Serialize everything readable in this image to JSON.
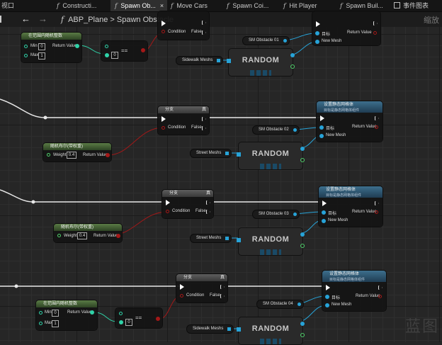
{
  "tabs": [
    {
      "label": "视口",
      "has_fx": false,
      "active": false
    },
    {
      "label": "Constructi...",
      "has_fx": true,
      "active": false
    },
    {
      "label": "Spawn Ob...",
      "has_fx": true,
      "active": true,
      "close": "×"
    },
    {
      "label": "Move Cars",
      "has_fx": true,
      "active": false
    },
    {
      "label": "Spawn Coi...",
      "has_fx": true,
      "active": false
    },
    {
      "label": "Hit Player",
      "has_fx": true,
      "active": false
    },
    {
      "label": "Spawn Buil...",
      "has_fx": true,
      "active": false
    },
    {
      "label": "事件图表",
      "has_fx": false,
      "active": false,
      "icon": "grid-icon"
    }
  ],
  "toolbar": {
    "breadcrumb_parent": "ABP_Plane",
    "breadcrumb_sep": ">",
    "breadcrumb_current": "Spawn Obstacle",
    "zoom_label": "缩放"
  },
  "watermark": "蓝图",
  "labels": {
    "random_int": "在范围内随机整数",
    "random_bool": "随机布尔(带权重)",
    "branch": "分支",
    "set_mesh": "设置静态网格体",
    "target_hint": "目标是静态网格体组件",
    "min": "Min",
    "max": "Max",
    "weight": "Weight",
    "return_value": "Return Value",
    "condition": "Condition",
    "true_lbl": "真",
    "false_lbl": "False",
    "target": "目标",
    "new_mesh": "New Mesh",
    "random": "RANDOM",
    "eq": "==",
    "sidewalk": "Sidewalk Meshs",
    "street": "Street Meshs"
  },
  "values": {
    "min_1": "0",
    "max_1": "1",
    "eq_1": "0",
    "weight_2": "0.4",
    "weight_3": "0.4",
    "min_4": "0",
    "max_4": "1",
    "eq_4": "0"
  },
  "obstacles": [
    "SM Obstacle 01",
    "SM Obstacle 02",
    "SM Obstacle 03",
    "SM Obstacle 04"
  ]
}
